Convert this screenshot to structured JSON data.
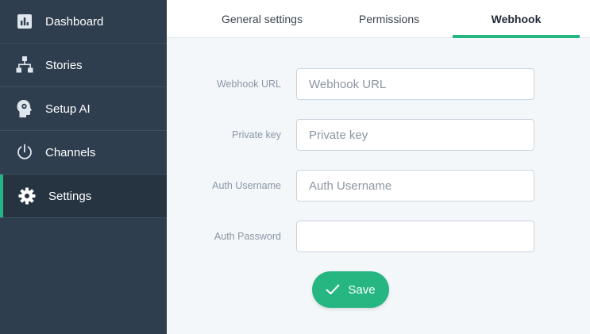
{
  "colors": {
    "sidebar_bg": "#2f3e4e",
    "accent": "#25b682",
    "content_bg": "#f4f7fa"
  },
  "sidebar": {
    "items": [
      {
        "label": "Dashboard",
        "icon": "dashboard-chart-icon",
        "active": false
      },
      {
        "label": "Stories",
        "icon": "sitemap-icon",
        "active": false
      },
      {
        "label": "Setup AI",
        "icon": "head-brain-icon",
        "active": false
      },
      {
        "label": "Channels",
        "icon": "power-icon",
        "active": false
      },
      {
        "label": "Settings",
        "icon": "gear-icon",
        "active": true
      }
    ]
  },
  "tabs": [
    {
      "label": "General settings",
      "active": false
    },
    {
      "label": "Permissions",
      "active": false
    },
    {
      "label": "Webhook",
      "active": true
    }
  ],
  "form": {
    "webhook_url": {
      "label": "Webhook URL",
      "placeholder": "Webhook URL",
      "value": ""
    },
    "private_key": {
      "label": "Private key",
      "placeholder": "Private key",
      "value": ""
    },
    "auth_username": {
      "label": "Auth Username",
      "placeholder": "Auth Username",
      "value": ""
    },
    "auth_password": {
      "label": "Auth Password",
      "placeholder": "",
      "value": ""
    }
  },
  "save_button": {
    "label": "Save",
    "icon": "check-icon"
  }
}
